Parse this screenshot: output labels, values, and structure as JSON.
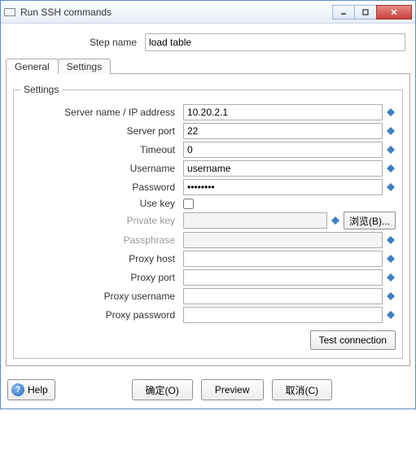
{
  "window": {
    "title": "Run SSH commands"
  },
  "step": {
    "label": "Step name",
    "value": "load table"
  },
  "tabs": {
    "general": "General",
    "settings": "Settings"
  },
  "group": {
    "legend": "Settings"
  },
  "fields": {
    "server_name": {
      "label": "Server name / IP address",
      "value": "10.20.2.1"
    },
    "server_port": {
      "label": "Server port",
      "value": "22"
    },
    "timeout": {
      "label": "Timeout",
      "value": "0"
    },
    "username": {
      "label": "Username",
      "value": "username"
    },
    "password": {
      "label": "Password",
      "value": "••••••••"
    },
    "use_key": {
      "label": "Use key"
    },
    "private_key": {
      "label": "Private key",
      "value": "",
      "browse": "浏览(B)..."
    },
    "passphrase": {
      "label": "Passphrase",
      "value": ""
    },
    "proxy_host": {
      "label": "Proxy host",
      "value": ""
    },
    "proxy_port": {
      "label": "Proxy port",
      "value": ""
    },
    "proxy_user": {
      "label": "Proxy username",
      "value": ""
    },
    "proxy_pass": {
      "label": "Proxy password",
      "value": ""
    }
  },
  "buttons": {
    "test": "Test connection",
    "help": "Help",
    "ok": "确定(O)",
    "preview": "Preview",
    "cancel": "取消(C)"
  }
}
